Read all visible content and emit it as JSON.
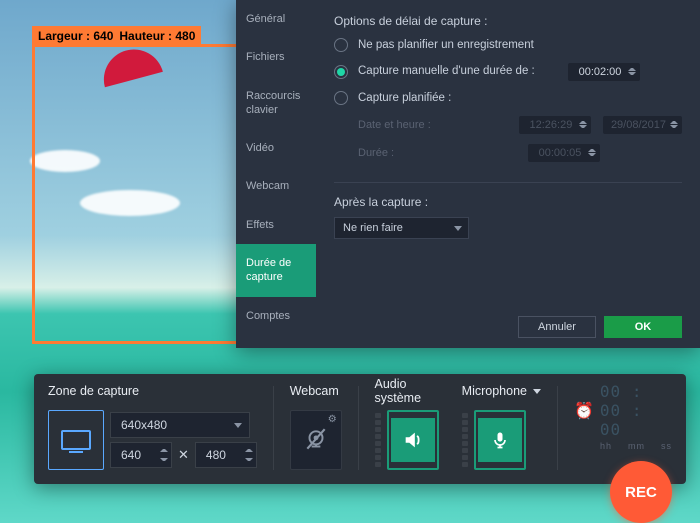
{
  "capture_area": {
    "label_width": "Largeur : 640",
    "label_height": "Hauteur : 480"
  },
  "dialog": {
    "sidebar": {
      "items": [
        {
          "label": "Général"
        },
        {
          "label": "Fichiers"
        },
        {
          "label": "Raccourcis clavier"
        },
        {
          "label": "Vidéo"
        },
        {
          "label": "Webcam"
        },
        {
          "label": "Effets"
        },
        {
          "label": "Durée de capture"
        },
        {
          "label": "Comptes"
        }
      ],
      "active_index": 6
    },
    "options_title": "Options de délai de capture :",
    "radios": {
      "none": "Ne pas planifier un enregistrement",
      "manual": "Capture manuelle d'une durée de :",
      "scheduled": "Capture planifiée :"
    },
    "manual_duration": "00:02:00",
    "scheduled": {
      "datetime_label": "Date et heure :",
      "time": "12:26:29",
      "date": "29/08/2017",
      "duration_label": "Durée :",
      "duration": "00:00:05"
    },
    "after_title": "Après la capture :",
    "after_select": "Ne rien faire",
    "btn_cancel": "Annuler",
    "btn_ok": "OK"
  },
  "toolbar": {
    "zone_title": "Zone de capture",
    "resolution": "640x480",
    "width": "640",
    "height": "480",
    "webcam_title": "Webcam",
    "audio_title": "Audio système",
    "mic_title": "Microphone",
    "timer": "00 : 00 : 00",
    "units": {
      "h": "hh",
      "m": "mm",
      "s": "ss"
    },
    "rec": "REC"
  }
}
